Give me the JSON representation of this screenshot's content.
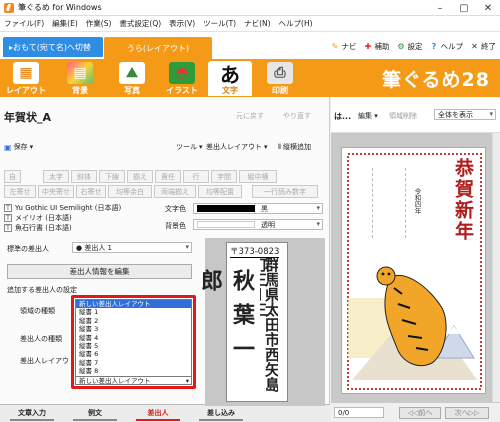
{
  "window": {
    "title": "筆ぐるめ for Windows"
  },
  "menu": [
    "ファイル(F)",
    "編集(E)",
    "作業(S)",
    "書式設定(Q)",
    "表示(V)",
    "ツール(T)",
    "ナビ(N)",
    "ヘルプ(H)"
  ],
  "modes": {
    "tab1": "▸おもて(宛て名)へ切替",
    "tab2": "うら(レイアウト)"
  },
  "toplinks": {
    "navi": "ナビ",
    "help_assist": "補助",
    "settings": "設定",
    "help": "ヘルプ",
    "exit": "終了"
  },
  "ribbon": {
    "items": [
      "レイアウト",
      "背景",
      "写真",
      "イラスト",
      "文字",
      "印刷"
    ],
    "active": "文字",
    "logo": "筆ぐるめ28"
  },
  "editor": {
    "doc_title": "年賀状_A",
    "undo": "元に戻す",
    "redo": "やり直す",
    "save": "保存",
    "tool": "ツール",
    "sender_layout": "差出人レイアウト",
    "vertical_add": "縦横追加",
    "format_buttons_row1": [
      "自",
      "太字",
      "斜体",
      "下線",
      "揃え",
      "責任",
      "行",
      "字間",
      "縦中横"
    ],
    "format_buttons_row2": [
      "左寄せ",
      "中央寄せ",
      "右寄せ",
      "均等余白",
      "両端揃え",
      "均等配置",
      "一行読み数字"
    ],
    "fonts": [
      "Yu Gothic UI Semilight (日本語)",
      "メイリオ (日本語)",
      "魚石行書 (日本語)"
    ],
    "text_color_label": "文字色",
    "text_color_value": "黒",
    "bg_color_label": "背景色",
    "bg_color_value": "透明",
    "standard_sender_label": "標準の差出人",
    "standard_sender_value": "● 差出人 1",
    "edit_sender_button": "差出人情報を編集",
    "sender_settings_label": "追加する差出人の設定",
    "field_labels": [
      "領域の種類",
      "差出人の種類",
      "差出人レイアウト"
    ],
    "dropdown_options": [
      "新しい差出人レイアウト",
      "縦書 1",
      "縦書 2",
      "縦書 3",
      "縦書 4",
      "縦書 5",
      "縦書 6",
      "縦書 7",
      "縦書 8"
    ],
    "dropdown_selected": "新しい差出人レイアウト",
    "preview": {
      "postal": "〒373-0823",
      "address": "群馬県太田市西矢島町三ー三",
      "name": "秋葉一郎"
    },
    "bottom_tabs": [
      "文章入力",
      "例文",
      "差出人",
      "差し込み"
    ],
    "active_tab": "差出人"
  },
  "right_panel": {
    "short_label": "は...",
    "edit": "編集",
    "delete_area": "領域削除",
    "view_select": "全体を表示",
    "card_text": [
      "恭賀新年",
      "令和四年"
    ],
    "page_counter": "0/0",
    "prev": "前へ",
    "next": "次へ"
  },
  "colors": {
    "ribbon": "#f59a17",
    "mode_blue": "#2f8de4",
    "highlight": "#e11919"
  }
}
